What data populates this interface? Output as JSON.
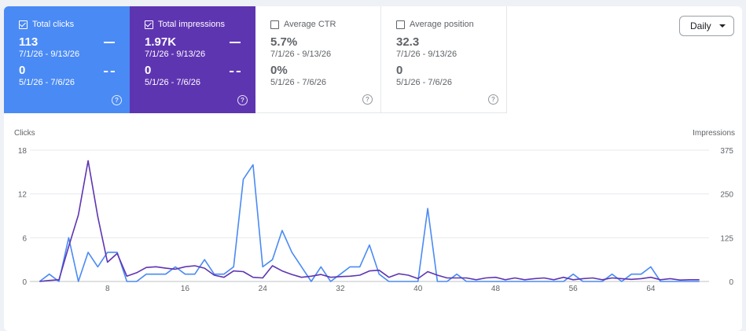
{
  "metrics": {
    "clicks": {
      "label": "Total clicks",
      "checked": true,
      "current": "113",
      "current_range": "7/1/26 - 9/13/26",
      "previous": "0",
      "previous_range": "5/1/26 - 7/6/26"
    },
    "impressions": {
      "label": "Total impressions",
      "checked": true,
      "current": "1.97K",
      "current_range": "7/1/26 - 9/13/26",
      "previous": "0",
      "previous_range": "5/1/26 - 7/6/26"
    },
    "ctr": {
      "label": "Average CTR",
      "checked": false,
      "current": "5.7%",
      "current_range": "7/1/26 - 9/13/26",
      "previous": "0%",
      "previous_range": "5/1/26 - 7/6/26"
    },
    "position": {
      "label": "Average position",
      "checked": false,
      "current": "32.3",
      "current_range": "7/1/26 - 9/13/26",
      "previous": "0",
      "previous_range": "5/1/26 - 7/6/26"
    }
  },
  "help_glyph": "?",
  "period_select": {
    "value": "Daily"
  },
  "colors": {
    "clicks": "#4a8af4",
    "impressions": "#5e35b1"
  },
  "icons": [
    "checkbox-icon",
    "help-icon",
    "caret-down-icon",
    "solid-line-legend-icon",
    "dashed-line-legend-icon"
  ],
  "chart_data": {
    "type": "line",
    "left_axis": {
      "label": "Clicks",
      "ylim": [
        0,
        18
      ],
      "ticks": [
        0,
        6,
        12,
        18
      ]
    },
    "right_axis": {
      "label": "Impressions",
      "ylim": [
        0,
        375
      ],
      "ticks": [
        0,
        125,
        250,
        375
      ]
    },
    "x_ticks": [
      8,
      16,
      24,
      32,
      40,
      48,
      56,
      64
    ],
    "xlim": [
      0,
      70
    ],
    "series": [
      {
        "name": "Total clicks",
        "axis": "left",
        "color": "#4a8af4",
        "x": [
          1,
          2,
          3,
          4,
          5,
          6,
          7,
          8,
          9,
          10,
          11,
          12,
          13,
          14,
          15,
          16,
          17,
          18,
          19,
          20,
          21,
          22,
          23,
          24,
          25,
          26,
          27,
          28,
          29,
          30,
          31,
          32,
          33,
          34,
          35,
          36,
          37,
          38,
          39,
          40,
          41,
          42,
          43,
          44,
          45,
          46,
          47,
          48,
          49,
          50,
          51,
          52,
          53,
          54,
          55,
          56,
          57,
          58,
          59,
          60,
          61,
          62,
          63,
          64,
          65,
          66,
          67,
          68,
          69
        ],
        "y": [
          0,
          1,
          0,
          6,
          0,
          4,
          2,
          4,
          4,
          0,
          0,
          1,
          1,
          1,
          2,
          1,
          1,
          3,
          1,
          1,
          2,
          14,
          16,
          2,
          3,
          7,
          4,
          2,
          0,
          2,
          0,
          1,
          2,
          2,
          5,
          1,
          0,
          0,
          0,
          0,
          10,
          0,
          0,
          1,
          0,
          0,
          0,
          0,
          0,
          0,
          0,
          0,
          0,
          0,
          0,
          1,
          0,
          0,
          0,
          1,
          0,
          1,
          1,
          2,
          0,
          0,
          0,
          0,
          0
        ]
      },
      {
        "name": "Total impressions",
        "axis": "right",
        "color": "#5e35b1",
        "x": [
          1,
          2,
          3,
          4,
          5,
          6,
          7,
          8,
          9,
          10,
          11,
          12,
          13,
          14,
          15,
          16,
          17,
          18,
          19,
          20,
          21,
          22,
          23,
          24,
          25,
          26,
          27,
          28,
          29,
          30,
          31,
          32,
          33,
          34,
          35,
          36,
          37,
          38,
          39,
          40,
          41,
          42,
          43,
          44,
          45,
          46,
          47,
          48,
          49,
          50,
          51,
          52,
          53,
          54,
          55,
          56,
          57,
          58,
          59,
          60,
          61,
          62,
          63,
          64,
          65,
          66,
          67,
          68,
          69
        ],
        "y": [
          0,
          3,
          5,
          100,
          190,
          345,
          185,
          55,
          80,
          15,
          25,
          40,
          42,
          38,
          35,
          42,
          45,
          38,
          18,
          12,
          30,
          28,
          12,
          10,
          45,
          30,
          20,
          12,
          15,
          20,
          12,
          14,
          15,
          18,
          30,
          32,
          12,
          22,
          18,
          8,
          28,
          18,
          10,
          10,
          10,
          5,
          10,
          12,
          5,
          10,
          5,
          8,
          10,
          5,
          12,
          5,
          8,
          10,
          5,
          10,
          8,
          6,
          8,
          12,
          5,
          8,
          4,
          5,
          5
        ]
      }
    ]
  }
}
